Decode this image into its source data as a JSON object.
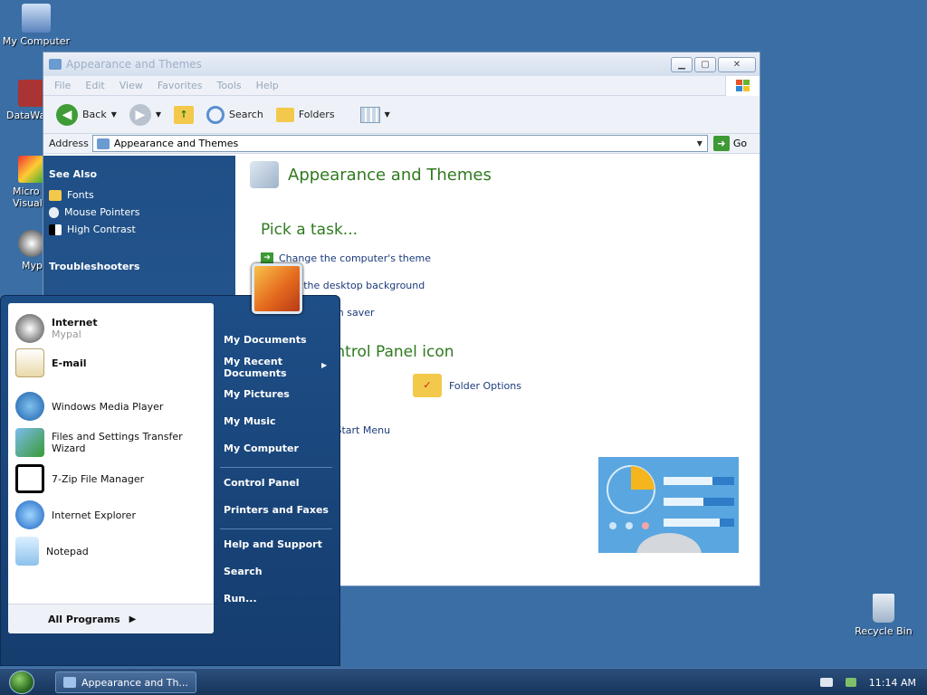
{
  "desktop": {
    "icons": [
      "My Computer",
      "Recycle Bin"
    ],
    "clipped_icons": [
      "DataWa",
      "Micro Visual",
      "Myp"
    ]
  },
  "window": {
    "title": "Appearance and Themes",
    "menu": [
      "File",
      "Edit",
      "View",
      "Favorites",
      "Tools",
      "Help"
    ],
    "toolbar": {
      "back": "Back",
      "search": "Search",
      "folders": "Folders"
    },
    "address": {
      "label": "Address",
      "value": "Appearance and Themes",
      "go": "Go"
    },
    "left_pane": {
      "see_also_title": "See Also",
      "see_also": [
        "Fonts",
        "Mouse Pointers",
        "High Contrast"
      ],
      "troubleshooters_title": "Troubleshooters"
    },
    "content": {
      "title": "Appearance and Themes",
      "pick_task": "Pick a task...",
      "tasks": [
        "Change the computer's theme",
        "ge the desktop background",
        "en saver"
      ],
      "pick_icon": "ontrol Panel icon",
      "folder_options": "Folder Options",
      "start_menu": "d Start Menu"
    }
  },
  "start_menu": {
    "pinned": [
      {
        "label": "Internet",
        "sub": "Mypal"
      },
      {
        "label": "E-mail"
      }
    ],
    "recent": [
      "Windows Media Player",
      "Files and Settings Transfer Wizard",
      "7-Zip File Manager",
      "Internet Explorer",
      "Notepad"
    ],
    "all_programs": "All Programs",
    "right": {
      "my_documents": "My Documents",
      "my_recent_documents": "My Recent Documents",
      "my_pictures": "My Pictures",
      "my_music": "My Music",
      "my_computer": "My Computer",
      "control_panel": "Control Panel",
      "printers_and_faxes": "Printers and Faxes",
      "help_and_support": "Help and Support",
      "search": "Search",
      "run": "Run..."
    }
  },
  "taskbar": {
    "task_button": "Appearance and Th...",
    "time": "11:14 AM"
  },
  "colors": {
    "desktop": "#3a6ea5",
    "start_menu": "#1e4e87",
    "link": "#1b3a7a",
    "heading_green": "#2f7a1f"
  }
}
